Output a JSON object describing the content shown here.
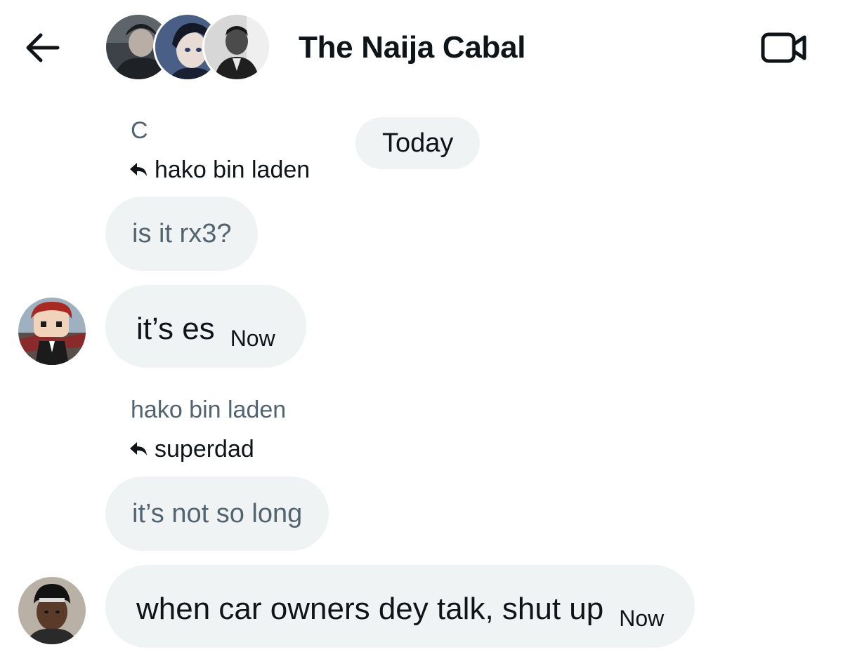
{
  "header": {
    "title": "The Naija Cabal",
    "back_icon": "arrow-left-icon",
    "video_icon": "video-camera-icon",
    "avatars": [
      "member-avatar-1",
      "member-avatar-2",
      "member-avatar-3"
    ]
  },
  "date_separator": "Today",
  "messages": [
    {
      "sender": "C",
      "reply_to": "hako bin laden",
      "quoted_text": "is it rx3?",
      "text": "it’s es",
      "time": "Now"
    },
    {
      "sender": "hako bin laden",
      "reply_to": "superdad",
      "quoted_text": "it’s not so long",
      "text": "when car owners dey talk, shut up",
      "time": "Now"
    }
  ],
  "colors": {
    "bubble": "#eff3f4",
    "secondary_text": "#536471",
    "primary_text": "#0f1419"
  }
}
